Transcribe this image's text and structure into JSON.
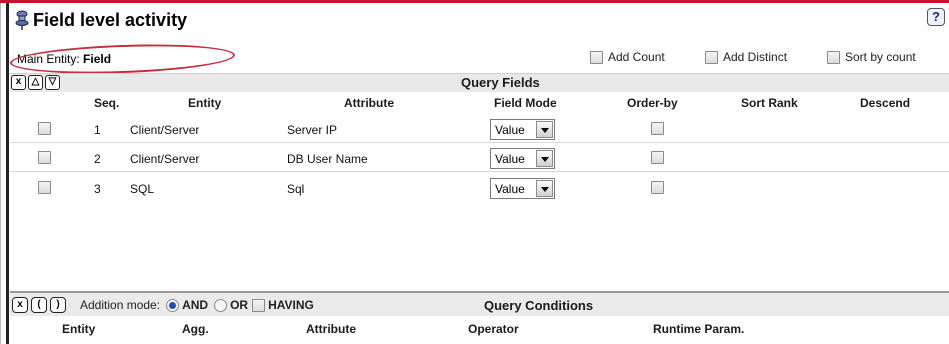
{
  "title": "Field level activity",
  "help_label": "?",
  "main_entity": {
    "label": "Main Entity:",
    "value": "Field"
  },
  "options": {
    "add_count": "Add Count",
    "add_distinct": "Add Distinct",
    "sort_by_count": "Sort by count"
  },
  "query_fields": {
    "title": "Query Fields",
    "buttons": {
      "remove": "x",
      "up": "△",
      "down": "▽"
    },
    "columns": {
      "seq": "Seq.",
      "entity": "Entity",
      "attribute": "Attribute",
      "field_mode": "Field Mode",
      "order_by": "Order-by",
      "sort_rank": "Sort Rank",
      "descend": "Descend"
    },
    "rows": [
      {
        "seq": "1",
        "entity": "Client/Server",
        "attribute": "Server IP",
        "field_mode": "Value"
      },
      {
        "seq": "2",
        "entity": "Client/Server",
        "attribute": "DB User Name",
        "field_mode": "Value"
      },
      {
        "seq": "3",
        "entity": "SQL",
        "attribute": "Sql",
        "field_mode": "Value"
      }
    ]
  },
  "query_conditions": {
    "title": "Query Conditions",
    "buttons": {
      "remove": "x",
      "open_paren": "(",
      "close_paren": ")"
    },
    "addition_mode_label": "Addition mode:",
    "modes": {
      "and": "AND",
      "or": "OR",
      "having": "HAVING"
    },
    "selected_mode": "AND",
    "columns": {
      "entity": "Entity",
      "agg": "Agg.",
      "attribute": "Attribute",
      "operator": "Operator",
      "runtime_param": "Runtime Param."
    }
  },
  "colors": {
    "top_border": "#c8102e",
    "annotation_ellipse": "#c4303a",
    "header_bg": "#e9e9e9"
  }
}
